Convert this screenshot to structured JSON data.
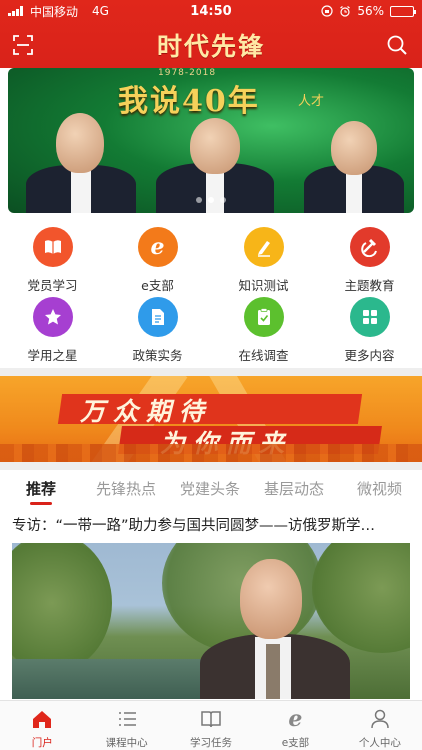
{
  "status_bar": {
    "carrier": "中国移动",
    "network": "4G",
    "time": "14:50",
    "battery": "56%",
    "battery_level": 0.56
  },
  "header": {
    "title": "时代先锋"
  },
  "banner": {
    "title": "我说40年",
    "subtitle": "人才",
    "years": "1978-2018",
    "slide_count": 3,
    "active_slide": 2
  },
  "menu": {
    "items": [
      {
        "label": "党员学习",
        "icon": "book-icon",
        "color": "#f2552c"
      },
      {
        "label": "e支部",
        "icon": "e-branch-icon",
        "color": "#f37a1a"
      },
      {
        "label": "知识测试",
        "icon": "pencil-icon",
        "color": "#f7b518"
      },
      {
        "label": "主题教育",
        "icon": "hammer-sickle-icon",
        "color": "#e23a2b"
      },
      {
        "label": "学用之星",
        "icon": "star-icon",
        "color": "#a63fd1"
      },
      {
        "label": "政策实务",
        "icon": "document-icon",
        "color": "#2f9bea"
      },
      {
        "label": "在线调查",
        "icon": "clipboard-check-icon",
        "color": "#5cc02e"
      },
      {
        "label": "更多内容",
        "icon": "grid-icon",
        "color": "#2bb88d"
      }
    ]
  },
  "promo": {
    "line1": "万众期待",
    "line2": "为你而来"
  },
  "tabs": [
    {
      "label": "推荐",
      "active": true
    },
    {
      "label": "先锋热点",
      "active": false
    },
    {
      "label": "党建头条",
      "active": false
    },
    {
      "label": "基层动态",
      "active": false
    },
    {
      "label": "微视频",
      "active": false
    }
  ],
  "article": {
    "title": "专访：“一带一路”助力参与国共同圆梦——访俄罗斯学…"
  },
  "bottom_nav": [
    {
      "label": "门户",
      "icon": "home-icon",
      "active": true
    },
    {
      "label": "课程中心",
      "icon": "list-icon",
      "active": false
    },
    {
      "label": "学习任务",
      "icon": "open-book-icon",
      "active": false
    },
    {
      "label": "e支部",
      "icon": "e-letter-icon",
      "active": false
    },
    {
      "label": "个人中心",
      "icon": "person-icon",
      "active": false
    }
  ],
  "colors": {
    "brand_red": "#d9221a",
    "title_gold": "#ffe9a6"
  }
}
